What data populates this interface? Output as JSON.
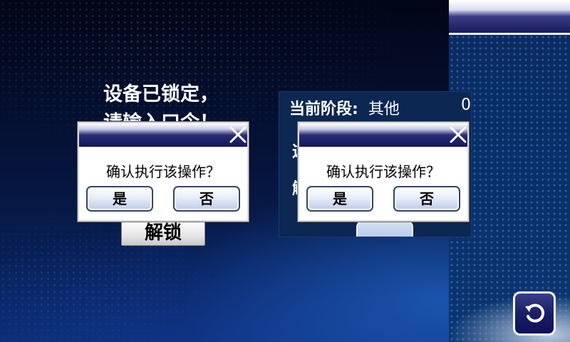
{
  "lock_screen": {
    "line1": "设备已锁定，",
    "line2": "请输入口令！",
    "unlock_label": "解锁"
  },
  "status_panel": {
    "stage_label": "当前阶段:",
    "stage_value": "其他",
    "stage_number": "0",
    "peek_text_1": "这",
    "peek_text_2": "解"
  },
  "dialogs": [
    {
      "message": "确认执行该操作？",
      "yes_label": "是",
      "no_label": "否"
    },
    {
      "message": "确认执行该操作？",
      "yes_label": "是",
      "no_label": "否"
    }
  ],
  "icons": {
    "close": "close-icon",
    "back": "back-arrow-icon"
  },
  "colors": {
    "title_bar": "#14175a",
    "background": "#061640",
    "button_face": "#e8eef8"
  }
}
